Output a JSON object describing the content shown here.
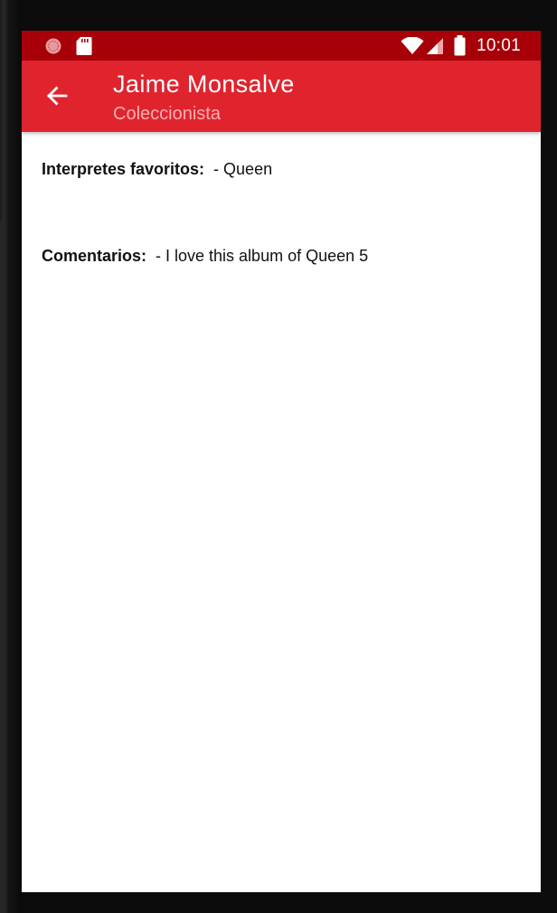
{
  "status_bar": {
    "time": "10:01",
    "left_icons": [
      "notification-dot-icon",
      "sd-card-icon"
    ],
    "right_icons": [
      "wifi-icon",
      "cell-signal-icon",
      "battery-icon"
    ]
  },
  "app_bar": {
    "back_icon": "arrow-back-icon",
    "title": "Jaime Monsalve",
    "subtitle": "Coleccionista"
  },
  "details": {
    "favorite_performers": {
      "label": "Interpretes favoritos:",
      "value": "- Queen"
    },
    "comments": {
      "label": "Comentarios:",
      "value": "- I love this album of Queen 5"
    }
  },
  "colors": {
    "status_bar": "#a80008",
    "app_bar": "#e0242e",
    "subtitle": "#f7b0b3",
    "background": "#ffffff"
  }
}
